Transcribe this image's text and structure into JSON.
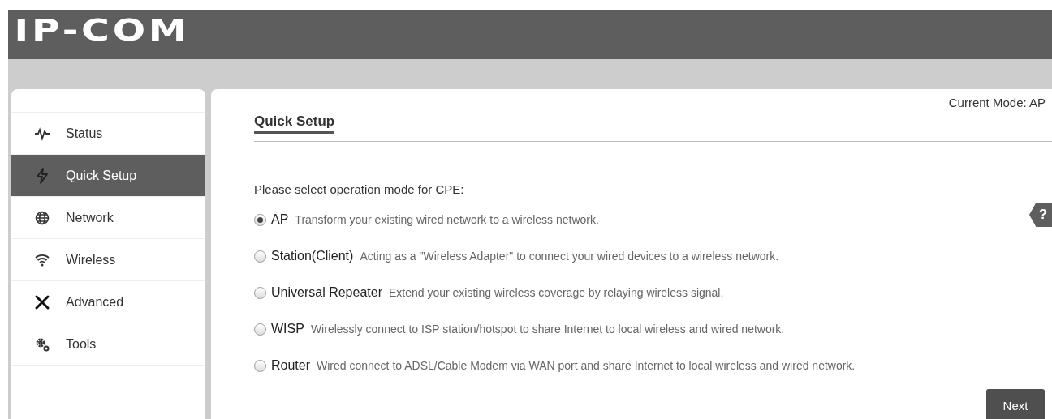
{
  "header": {
    "logo": "IP-COM"
  },
  "sidebar": {
    "items": [
      {
        "label": "Status",
        "selected": false
      },
      {
        "label": "Quick Setup",
        "selected": true
      },
      {
        "label": "Network",
        "selected": false
      },
      {
        "label": "Wireless",
        "selected": false
      },
      {
        "label": "Advanced",
        "selected": false
      },
      {
        "label": "Tools",
        "selected": false
      }
    ]
  },
  "main": {
    "current_mode": "Current Mode: AP",
    "title": "Quick Setup",
    "help": "?",
    "prompt": "Please select operation mode for CPE:",
    "modes": [
      {
        "label": "AP",
        "description": "Transform your existing wired network to a wireless network.",
        "selected": true
      },
      {
        "label": "Station(Client)",
        "description": "Acting as a \"Wireless Adapter\" to connect your wired devices to a wireless network.",
        "selected": false
      },
      {
        "label": "Universal Repeater",
        "description": "Extend your existing wireless coverage by relaying wireless signal.",
        "selected": false
      },
      {
        "label": "WISP",
        "description": "Wirelessly connect to ISP station/hotspot to share Internet to local wireless and wired network.",
        "selected": false
      },
      {
        "label": "Router",
        "description": "Wired connect to ADSL/Cable Modem via WAN port and share Internet to local wireless and wired network.",
        "selected": false
      }
    ],
    "next_button": "Next"
  }
}
